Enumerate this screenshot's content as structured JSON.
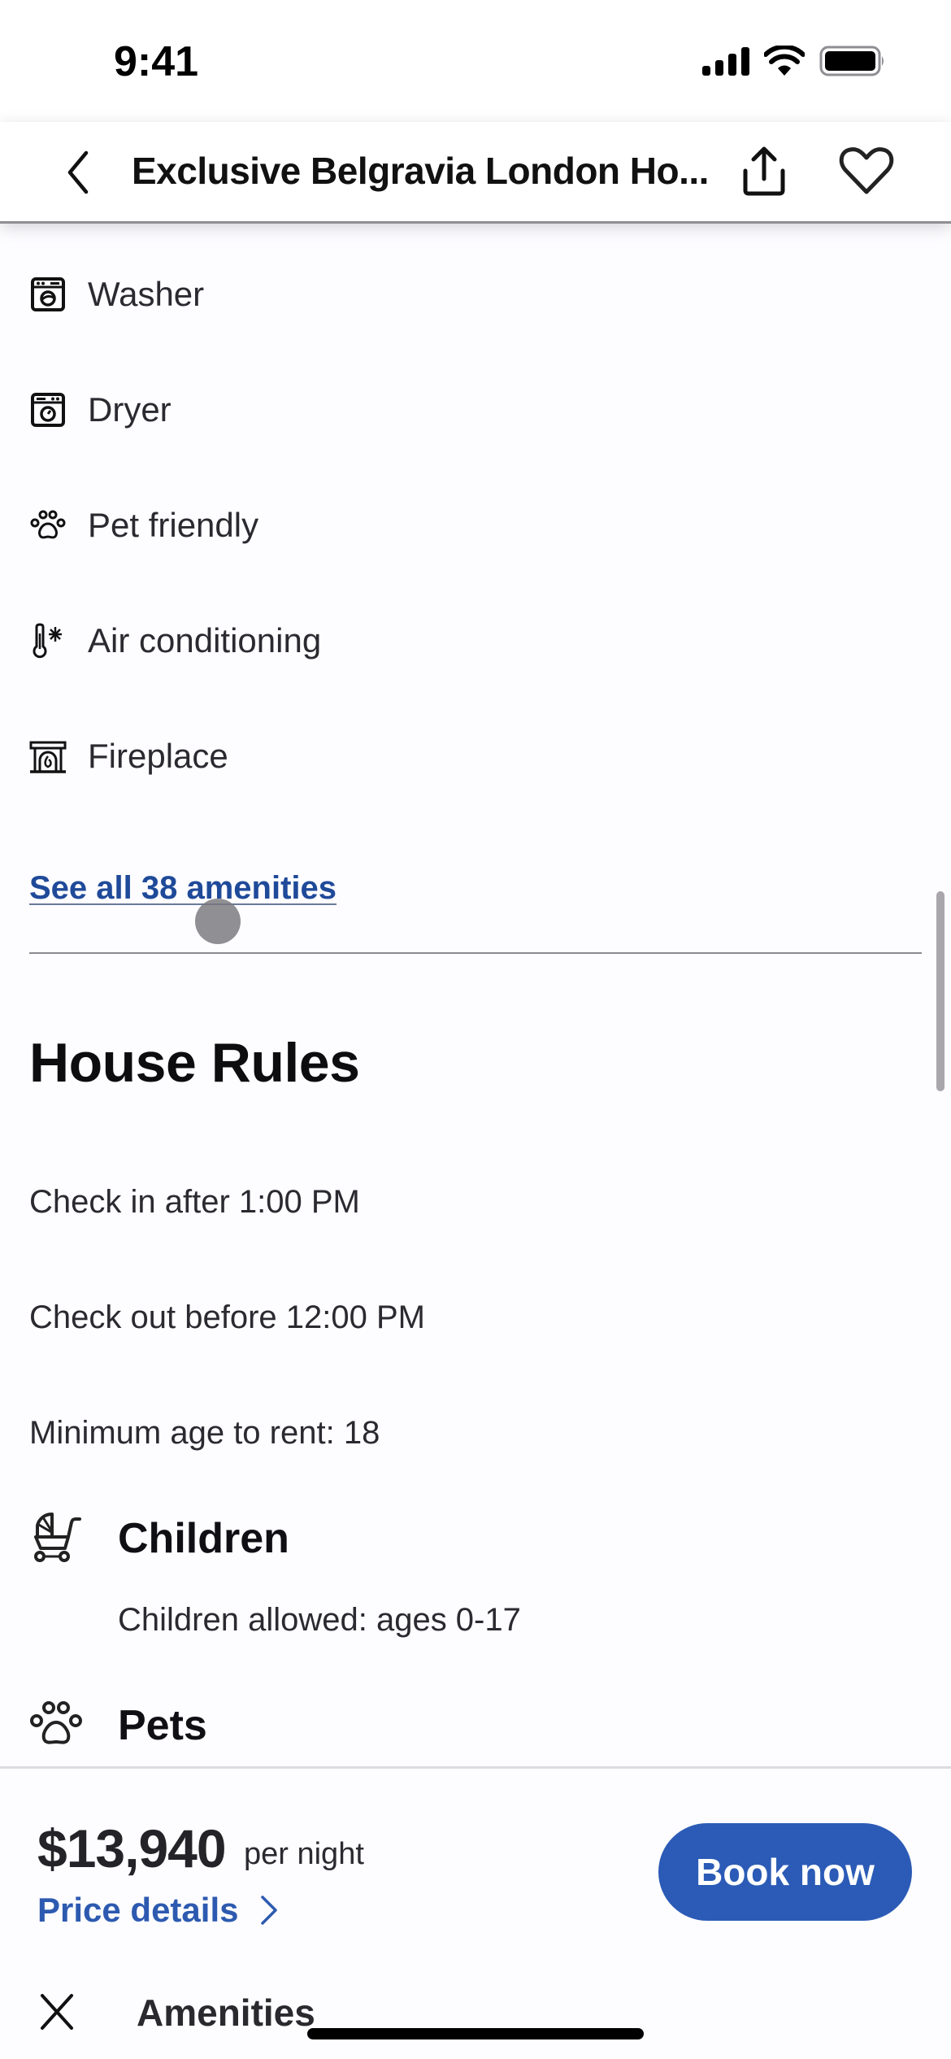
{
  "status_bar": {
    "time": "9:41",
    "icons": [
      "cellular-signal-icon",
      "wifi-icon",
      "battery-icon"
    ]
  },
  "header": {
    "title": "Exclusive Belgravia London Ho...",
    "back_icon": "chevron-left-icon",
    "share_icon": "share-icon",
    "favorite_icon": "heart-outline-icon"
  },
  "amenities": {
    "items": [
      {
        "label": "Washer",
        "icon": "washer-icon"
      },
      {
        "label": "Dryer",
        "icon": "dryer-icon"
      },
      {
        "label": "Pet friendly",
        "icon": "paw-icon"
      },
      {
        "label": "Air conditioning",
        "icon": "thermometer-snowflake-icon"
      },
      {
        "label": "Fireplace",
        "icon": "fireplace-icon"
      }
    ],
    "see_all_label": "See all 38 amenities"
  },
  "house_rules": {
    "title": "House Rules",
    "lines": [
      "Check in after 1:00 PM",
      "Check out before 12:00 PM",
      "Minimum age to rent: 18"
    ],
    "groups": [
      {
        "title": "Children",
        "icon": "stroller-icon",
        "description": "Children allowed: ages 0-17"
      },
      {
        "title": "Pets",
        "icon": "paw-icon",
        "description": ""
      }
    ]
  },
  "booking": {
    "price": "$13,940",
    "price_unit": "per night",
    "price_details_label": "Price details",
    "book_button_label": "Book now"
  },
  "sheet": {
    "title": "Amenities",
    "close_icon": "close-icon"
  },
  "colors": {
    "link_blue": "#1f4a99",
    "primary_button": "#2b5bb6",
    "price_details_blue": "#2d5ab0",
    "background": "#fdfcff"
  }
}
